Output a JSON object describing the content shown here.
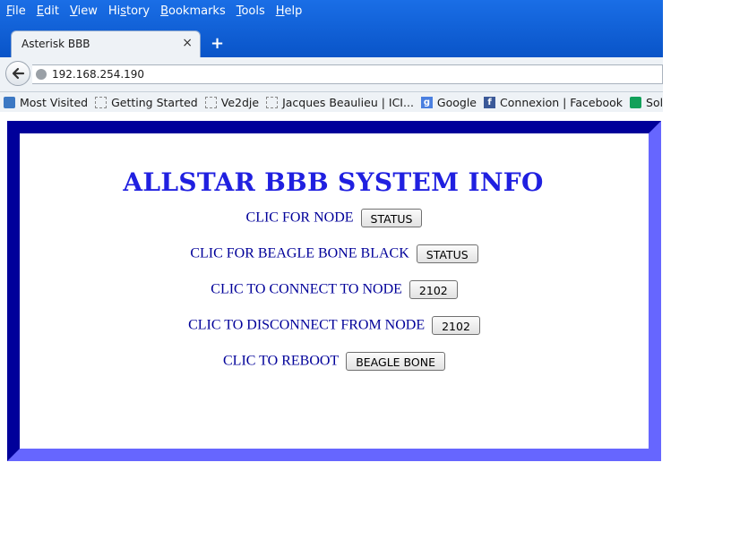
{
  "browser": {
    "menu": [
      "File",
      "Edit",
      "View",
      "History",
      "Bookmarks",
      "Tools",
      "Help"
    ],
    "menu_underline_index": [
      0,
      0,
      0,
      2,
      0,
      0,
      0
    ],
    "tab_title": "Asterisk BBB",
    "tab_close": "×",
    "new_tab": "+",
    "url": "192.168.254.190",
    "bookmarks": [
      {
        "label": "Most Visited",
        "icon": "most-visited-icon"
      },
      {
        "label": "Getting Started",
        "icon": "page-icon"
      },
      {
        "label": "Ve2dje",
        "icon": "page-icon"
      },
      {
        "label": "Jacques Beaulieu | ICI...",
        "icon": "page-icon"
      },
      {
        "label": "Google",
        "icon": "google-icon"
      },
      {
        "label": "Connexion | Facebook",
        "icon": "facebook-icon"
      },
      {
        "label": "Solutions",
        "icon": "solutions-icon"
      }
    ]
  },
  "page": {
    "title": "ALLSTAR BBB SYSTEM INFO",
    "rows": [
      {
        "label": "CLIC FOR NODE",
        "button": "STATUS"
      },
      {
        "label": "CLIC FOR BEAGLE BONE BLACK",
        "button": "STATUS"
      },
      {
        "label": "CLIC TO CONNECT TO NODE",
        "button": "2102"
      },
      {
        "label": "CLIC TO DISCONNECT FROM NODE",
        "button": "2102"
      },
      {
        "label": "CLIC TO REBOOT",
        "button": "BEAGLE BONE"
      }
    ]
  },
  "colors": {
    "chrome_blue": "#0954c8",
    "frame_dark": "#00009a",
    "frame_light": "#6666ff",
    "title_blue": "#2020e0",
    "text_navy": "#000099"
  }
}
